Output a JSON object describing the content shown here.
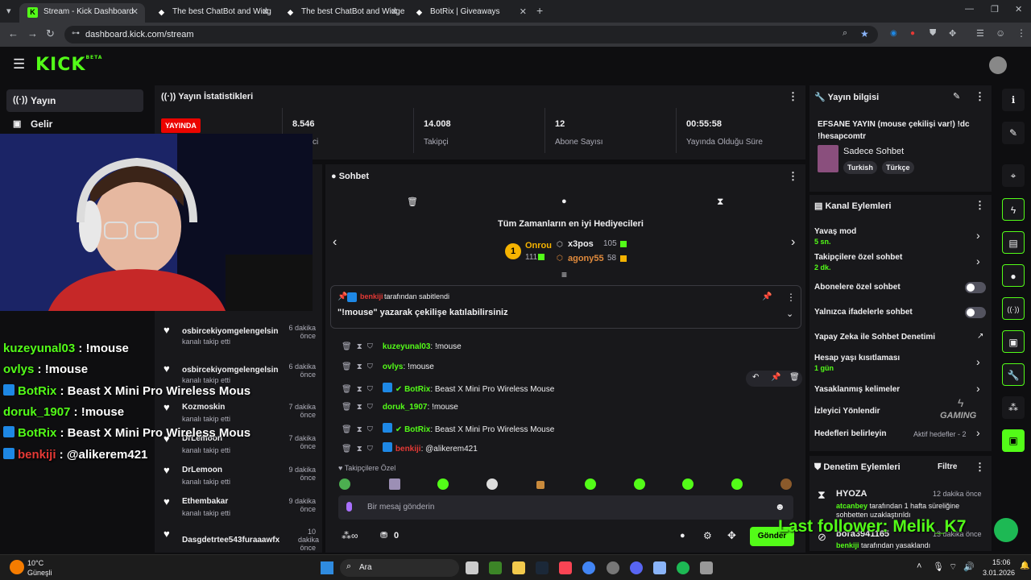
{
  "browser": {
    "tabs": [
      {
        "title": "Stream - Kick Dashboard",
        "active": true
      },
      {
        "title": "The best ChatBot and Widg",
        "active": false
      },
      {
        "title": "The best ChatBot and Widgets",
        "active": false
      },
      {
        "title": "BotRix | Giveaways",
        "active": false
      }
    ],
    "url": "dashboard.kick.com/stream"
  },
  "brand": {
    "logo": "KICK",
    "beta": "BETA",
    "accent": "#53fc18"
  },
  "sidebar": {
    "items": [
      {
        "label": "Yayın",
        "icon": "broadcast-icon"
      },
      {
        "label": "Gelir",
        "icon": "revenue-icon"
      }
    ]
  },
  "stats": {
    "title": "Yayın İstatistikleri",
    "live_label": "YAYINDA",
    "viewers_value": "8.546",
    "viewers_label_partial": "ci",
    "followers_value": "14.008",
    "followers_label": "Takipçi",
    "subs_value": "12",
    "subs_label": "Abone Sayısı",
    "uptime_value": "00:55:58",
    "uptime_label": "Yayında Olduğu Süre"
  },
  "stream_info": {
    "title": "Yayın bilgisi",
    "stream_title": "EFSANE YAYIN (mouse çekilişi var!) !dc !hesapcomtr",
    "category": "Sadece Sohbet",
    "tags": [
      "Turkish",
      "Türkçe"
    ]
  },
  "chat": {
    "title": "Sohbet",
    "top_gifters_title": "Tüm Zamanların en iyi Hediyecileri",
    "gifters": [
      {
        "name": "Onrou",
        "count": "111"
      },
      {
        "name": "x3pos",
        "count": "105"
      },
      {
        "name": "agony55",
        "count": "58"
      }
    ],
    "pinned": {
      "by": "benkiji",
      "by_suffix": "tarafından sabitlendi",
      "text": "\"!mouse\" yazarak çekilişe katılabilirsiniz"
    },
    "messages": [
      {
        "user": "kuzeyunal03",
        "text": "!mouse",
        "color": "green",
        "bot": false
      },
      {
        "user": "ovlys",
        "text": "!mouse",
        "color": "green",
        "bot": false
      },
      {
        "user": "BotRix",
        "text": "Beast X Mini Pro Wireless Mouse",
        "color": "green",
        "bot": true
      },
      {
        "user": "doruk_1907",
        "text": "!mouse",
        "color": "green",
        "bot": false
      },
      {
        "user": "BotRix",
        "text": "Beast X Mini Pro Wireless Mouse",
        "color": "green",
        "bot": true
      },
      {
        "user": "benkiji",
        "text": "@alikerem421",
        "color": "red",
        "bot": false
      }
    ],
    "followers_only_label": "Takipçilere Özel",
    "input_placeholder": "Bir mesaj gönderin",
    "points": "0",
    "send_label": "Gönder"
  },
  "overlay_chat": [
    {
      "user": "kuzeyunal03",
      "text": " : !mouse"
    },
    {
      "user": "ovlys",
      "text": " : !mouse"
    },
    {
      "user": "BotRix",
      "text": " : Beast X Mini Pro Wireless Mous"
    },
    {
      "user": "doruk_1907",
      "text": " : !mouse"
    },
    {
      "user": "BotRix",
      "text": " : Beast X Mini Pro Wireless Mous"
    },
    {
      "user": "benkiji",
      "text": " : @alikerem421"
    }
  ],
  "followers_feed": [
    {
      "name": "osbircekiyomgelengelsin",
      "sub": "kanalı takip etti",
      "time": "6 dakika önce"
    },
    {
      "name": "osbircekiyomgelengelsin",
      "sub": "kanalı takip etti",
      "time": "6 dakika önce"
    },
    {
      "name": "Kozmoskin",
      "sub": "kanalı takip etti",
      "time": "7 dakika önce"
    },
    {
      "name": "DrLemoon",
      "sub": "kanalı takip etti",
      "time": "7 dakika önce"
    },
    {
      "name": "DrLemoon",
      "sub": "kanalı takip etti",
      "time": "9 dakika önce"
    },
    {
      "name": "Ethembakar",
      "sub": "kanalı takip etti",
      "time": "9 dakika önce"
    },
    {
      "name": "Dasgdetrtee543furaaawfx",
      "sub": "",
      "time": "10 dakika önce"
    }
  ],
  "channel_actions": {
    "title": "Kanal Eylemleri",
    "slow_mode": {
      "label": "Yavaş mod",
      "value": "5 sn."
    },
    "followers_chat": {
      "label": "Takipçilere özel sohbet",
      "value": "2 dk."
    },
    "subs_chat": "Abonelere özel sohbet",
    "emotes_only": "Yalnızca ifadelerle sohbet",
    "ai_mod": "Yapay Zeka ile Sohbet Denetimi",
    "age_limit": {
      "label": "Hesap yaşı kısıtlaması",
      "value": "1 gün"
    },
    "banned_words": "Yasaklanmış kelimeler",
    "redirect": "İzleyici Yönlendir",
    "goals": {
      "label": "Hedefleri belirleyin",
      "value": "Aktif hedefler - 2"
    }
  },
  "mod_actions": {
    "title": "Denetim Eylemleri",
    "filter": "Filtre",
    "items": [
      {
        "user": "HYOZA",
        "time": "12 dakika önce",
        "by": "atcanbey",
        "text": "tarafından 1 hafta süreliğine sohbetten uzaklaştırıldı"
      },
      {
        "user": "bora3941165",
        "time": "13 dakika önce",
        "by": "benkiji",
        "text": "tarafından yasaklandı"
      }
    ]
  },
  "last_follower_banner": "Last follower: Melik_K7",
  "taskbar": {
    "weather_temp": "10°C",
    "weather_label": "Güneşli",
    "search": "Ara",
    "time": "15:06",
    "date": "3.01.2026"
  },
  "watermark": {
    "text": "GAMING"
  }
}
